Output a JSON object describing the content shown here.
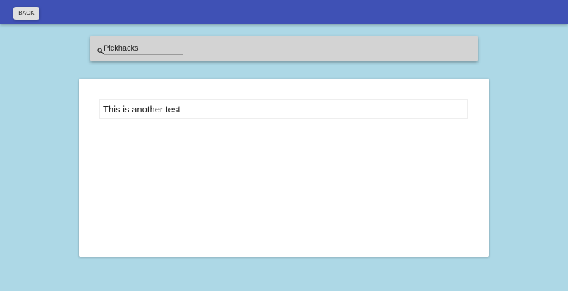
{
  "header": {
    "back_label": "BACK",
    "background_color": "#3f51b5"
  },
  "search": {
    "value": "Pickhacks",
    "icon": "search-icon"
  },
  "content": {
    "items": [
      {
        "text": "This is another test"
      }
    ]
  },
  "colors": {
    "page_background": "#add8e6",
    "search_bar_background": "#d3d3d3",
    "card_background": "#ffffff"
  }
}
